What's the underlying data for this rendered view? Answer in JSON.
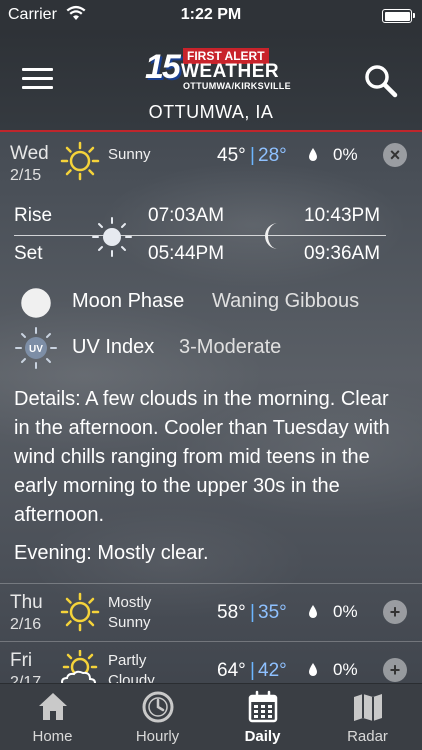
{
  "status_bar": {
    "carrier": "Carrier",
    "time": "1:22 PM"
  },
  "header": {
    "logo_number": "15",
    "logo_alert": "FIRST ALERT",
    "logo_weather": "WEATHER",
    "logo_sub": "OTTUMWA/KIRKSVILLE",
    "location": "OTTUMWA, IA"
  },
  "days": [
    {
      "day": "Wed",
      "date": "2/15",
      "condition": "Sunny",
      "high": "45°",
      "low": "28°",
      "precip": "0%",
      "icon": "sun-icon",
      "expanded": true
    },
    {
      "day": "Thu",
      "date": "2/16",
      "condition": "Mostly Sunny",
      "high": "58°",
      "low": "35°",
      "precip": "0%",
      "icon": "sun-icon",
      "expanded": false
    },
    {
      "day": "Fri",
      "date": "2/17",
      "condition": "Partly Cloudy",
      "high": "64°",
      "low": "42°",
      "precip": "0%",
      "icon": "partly-cloudy-icon",
      "expanded": false
    }
  ],
  "sep": "|",
  "detail": {
    "rise_label": "Rise",
    "set_label": "Set",
    "sunrise": "07:03AM",
    "sunset": "05:44PM",
    "moonrise": "10:43PM",
    "moonset": "09:36AM",
    "moon_phase_label": "Moon Phase",
    "moon_phase_value": "Waning Gibbous",
    "uv_label": "UV Index",
    "uv_value": "3-Moderate",
    "uv_badge": "UV",
    "details_text": "Details: A few clouds in the morning. Clear in the afternoon. Cooler than Tuesday with wind chills ranging from mid teens in the early morning to the upper 30s in the afternoon.",
    "evening_text": "Evening: Mostly clear."
  },
  "collapse_glyph": "×",
  "expand_glyph": "+",
  "tabs": [
    {
      "label": "Home",
      "icon": "home-icon"
    },
    {
      "label": "Hourly",
      "icon": "clock-icon"
    },
    {
      "label": "Daily",
      "icon": "calendar-icon",
      "active": true
    },
    {
      "label": "Radar",
      "icon": "map-icon"
    }
  ],
  "colors": {
    "accent_red": "#c0262c",
    "low_temp": "#8fc1ff",
    "sun": "#f5d33a"
  }
}
